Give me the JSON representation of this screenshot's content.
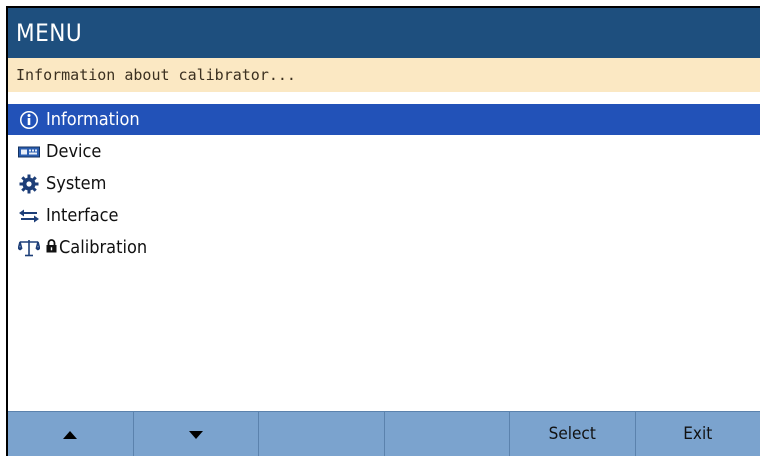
{
  "header": {
    "title": "MENU"
  },
  "status": {
    "text": "Information about calibrator..."
  },
  "menu": {
    "items": [
      {
        "label": "Information",
        "icon": "info-icon",
        "selected": true
      },
      {
        "label": "Device",
        "icon": "device-icon",
        "selected": false
      },
      {
        "label": "System",
        "icon": "gear-icon",
        "selected": false
      },
      {
        "label": "Interface",
        "icon": "interface-arrows-icon",
        "selected": false
      },
      {
        "label": "Calibration",
        "icon": "scale-icon",
        "selected": false,
        "locked": true
      }
    ]
  },
  "softkeys": {
    "keys": [
      {
        "label": "",
        "icon": "arrow-up-icon"
      },
      {
        "label": "",
        "icon": "arrow-down-icon"
      },
      {
        "label": ""
      },
      {
        "label": ""
      },
      {
        "label": "Select"
      },
      {
        "label": "Exit"
      }
    ]
  },
  "colors": {
    "title_bg": "#1e4f7e",
    "info_bg": "#fbe8c3",
    "selection_bg": "#2252b8",
    "softkey_bg": "#7ba3ce"
  }
}
